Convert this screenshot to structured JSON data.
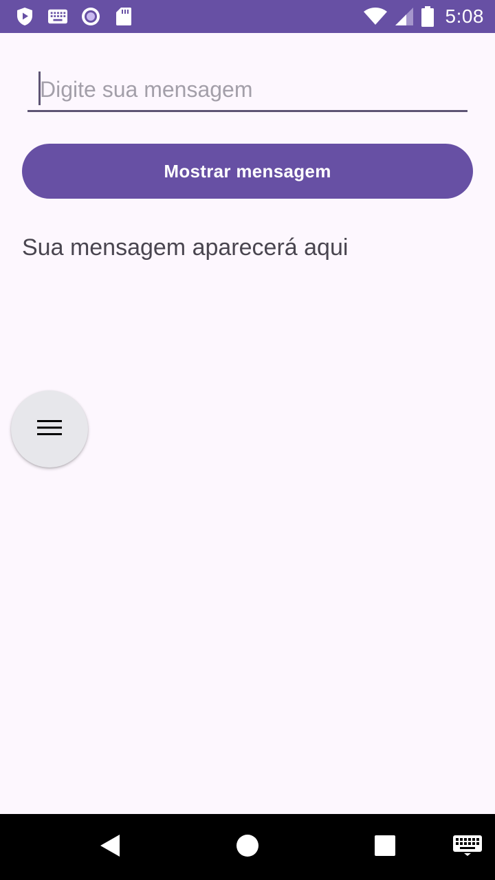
{
  "status_bar": {
    "time": "5:08",
    "icons_left": [
      "shield-play-icon",
      "keyboard-icon",
      "record-icon",
      "sd-card-icon"
    ],
    "icons_right": [
      "wifi-icon",
      "cell-signal-icon",
      "battery-icon"
    ]
  },
  "form": {
    "input_placeholder": "Digite sua mensagem",
    "input_value": "",
    "button_label": "Mostrar mensagem",
    "output_text": "Sua mensagem aparecerá aqui"
  },
  "fab": {
    "icon": "menu-icon"
  },
  "nav_bar": {
    "icons": [
      "back-icon",
      "home-icon",
      "recents-icon",
      "keyboard-icon"
    ]
  },
  "colors": {
    "primary": "#6750a4",
    "background": "#fdf7fe",
    "placeholder": "#a39fa9",
    "text": "#49454f",
    "fab_background": "#e7e7eb"
  }
}
